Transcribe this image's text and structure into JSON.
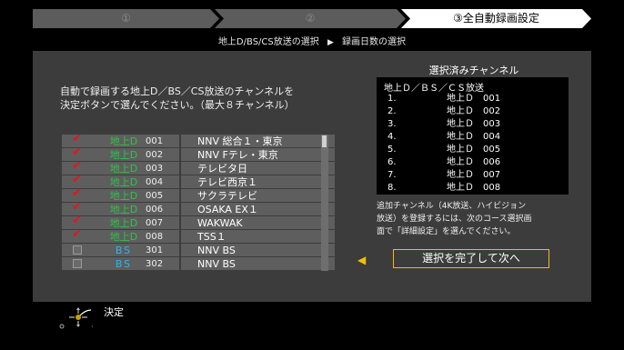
{
  "steps": [
    {
      "label": "①"
    },
    {
      "label": "②"
    },
    {
      "label": "③全自動録画設定"
    }
  ],
  "subtitle": {
    "current": "地上D/BS/CS放送の選択",
    "next": "録画日数の選択"
  },
  "instruction": "自動で録画する地上D／BS／CS放送のチャンネルを\n決定ボタンで選んでください。（最大８チャンネル）",
  "channels": [
    {
      "checked": true,
      "type": "地上D",
      "number": "001",
      "name": "NNV 総合１・東京"
    },
    {
      "checked": true,
      "type": "地上D",
      "number": "002",
      "name": "NNV Fテレ・東京"
    },
    {
      "checked": true,
      "type": "地上D",
      "number": "003",
      "name": "テレビタ日"
    },
    {
      "checked": true,
      "type": "地上D",
      "number": "004",
      "name": "テレビ西京１"
    },
    {
      "checked": true,
      "type": "地上D",
      "number": "005",
      "name": "サクラテレビ"
    },
    {
      "checked": true,
      "type": "地上D",
      "number": "006",
      "name": "OSAKA EX１"
    },
    {
      "checked": true,
      "type": "地上D",
      "number": "007",
      "name": "WAKWAK"
    },
    {
      "checked": true,
      "type": "地上D",
      "number": "008",
      "name": "TSS１"
    },
    {
      "checked": false,
      "type": "BS",
      "number": "301",
      "name": "NNV BS"
    },
    {
      "checked": false,
      "type": "BS",
      "number": "302",
      "name": "NNV BS"
    }
  ],
  "selected": {
    "title": "選択済みチャンネル",
    "header": "地上Ｄ／ＢＳ／ＣＳ放送",
    "items": [
      {
        "index": "1.",
        "type": "地上Ｄ",
        "number": "001"
      },
      {
        "index": "2.",
        "type": "地上Ｄ",
        "number": "002"
      },
      {
        "index": "3.",
        "type": "地上Ｄ",
        "number": "003"
      },
      {
        "index": "4.",
        "type": "地上Ｄ",
        "number": "004"
      },
      {
        "index": "5.",
        "type": "地上Ｄ",
        "number": "005"
      },
      {
        "index": "6.",
        "type": "地上Ｄ",
        "number": "006"
      },
      {
        "index": "7.",
        "type": "地上Ｄ",
        "number": "007"
      },
      {
        "index": "8.",
        "type": "地上Ｄ",
        "number": "008"
      }
    ]
  },
  "note": "追加チャンネル（4K放送、ハイビジョン\n放送）を登録するには、次のコース選択画\n面で「詳細設定」を選んでください。",
  "done_button": "選択を完了して次へ",
  "help": {
    "enter_label": "決定"
  },
  "colors": {
    "accent": "#f0c000",
    "terrestrial": "#30c24a",
    "bs": "#2cb6ea",
    "check": "#e0161d"
  }
}
